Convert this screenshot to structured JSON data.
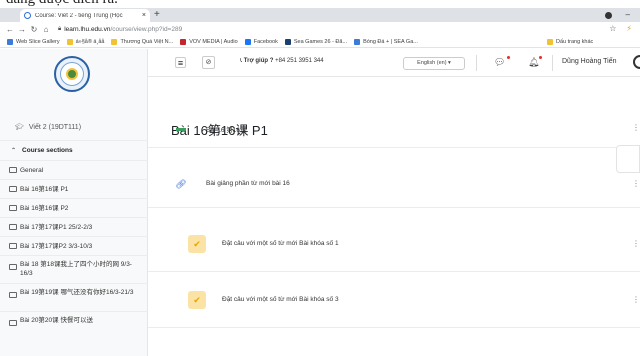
{
  "caption": {
    "text": "đang được diễn ra."
  },
  "browser": {
    "tab_title": "Course: Viết 2 - tiếng Trung (Học",
    "tab_close": "×",
    "new_tab": "+",
    "url_host": "learn.lhu.edu.vn",
    "url_path": "/course/view.php?id=289",
    "bookmarks": [
      {
        "label": "Web Slice Gallery",
        "color": "#3c7bd9"
      },
      {
        "label": "á»§å® ä¸­åå",
        "color": "#f1c232"
      },
      {
        "label": "Thương Quá Việt N...",
        "color": "#f1c232"
      },
      {
        "label": "VOV MEDIA | Audio",
        "color": "#c1272d"
      },
      {
        "label": "Facebook",
        "color": "#1877f2"
      },
      {
        "label": "Sea Games 26 - Đã...",
        "color": "#1b3e73"
      },
      {
        "label": "Bóng Đá + | SEA Ga...",
        "color": "#3c7bd9"
      }
    ],
    "bookmarks_right": "Dấu trang khác"
  },
  "topbar": {
    "hamburger": "≡",
    "help_label": "Trợ giúp ?",
    "help_phone": "+84 251 3951 344",
    "language": "English (en) ▾",
    "user_name": "Dũng Hoàng Tiến"
  },
  "sidebar": {
    "course_link": "Viết 2 (19DT111)",
    "section_header": "Course sections",
    "items": [
      {
        "label": "General",
        "tall": false
      },
      {
        "label": "Bài 16第16课 P1",
        "tall": false
      },
      {
        "label": "Bài 16第16课 P2",
        "tall": false
      },
      {
        "label": "Bài 17第17课P1 25/2-2/3",
        "tall": false
      },
      {
        "label": "Bài 17第17课P2 3/3-10/3",
        "tall": false
      },
      {
        "label": "Bài 18 第18课我上了四个小时的网 9/3-16/3",
        "tall": true
      },
      {
        "label": "Bài 19第19课 哪气还没有你好16/3-21/3",
        "tall": true
      },
      {
        "label": "Bài 20第20课 快餐可以送",
        "tall": true
      }
    ]
  },
  "main": {
    "page_title": "Bài 16第16课 P1",
    "activities": [
      {
        "label": "Bài 16 第16课",
        "icon": "forum-icon",
        "color": "#3d9d5f"
      },
      {
        "label": "Bài giảng phần từ mới bài 16",
        "icon": "link-icon",
        "color": "#3c6fd9"
      },
      {
        "label": "Đặt câu với một số từ mới Bài khóa số 1",
        "icon": "checkmark-icon",
        "color": "#e9a600"
      },
      {
        "label": "Đặt câu với một số từ mới Bài khóa số 3",
        "icon": "checkmark-icon",
        "color": "#e9a600"
      }
    ]
  }
}
